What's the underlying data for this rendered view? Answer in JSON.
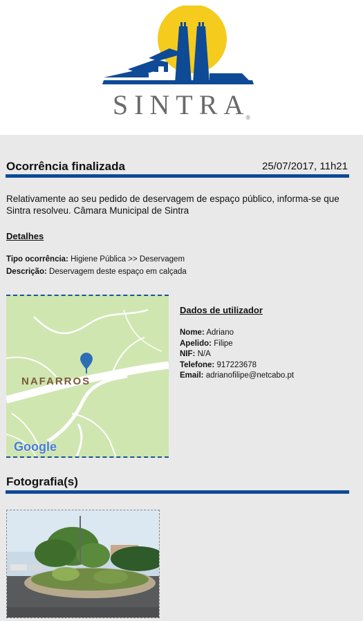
{
  "brand": {
    "name": "SINTRA",
    "mark": "®"
  },
  "notice": {
    "title": "Ocorrência finalizada",
    "date": "25/07/2017, 11h21",
    "message": "Relativamente ao seu pedido de deservagem de espaço público, informa-se que Sintra resolveu. Câmara Municipal de Sintra"
  },
  "details": {
    "heading": "Detalhes",
    "type_label": "Tipo ocorrência:",
    "type_value": "Higiene Pública >> Deservagem",
    "desc_label": "Descrição:",
    "desc_value": "Deservagem deste espaço em calçada"
  },
  "map": {
    "place": "NAFARROS",
    "provider": "Google"
  },
  "user": {
    "heading": "Dados de utilizador",
    "name_label": "Nome:",
    "name_value": "Adriano",
    "surname_label": "Apelido:",
    "surname_value": "Filipe",
    "nif_label": "NIF:",
    "nif_value": "N/A",
    "phone_label": "Telefone:",
    "phone_value": "917223678",
    "email_label": "Email:",
    "email_value": "adrianofilipe@netcabo.pt"
  },
  "photos": {
    "title": "Fotografia(s)"
  },
  "colors": {
    "accent": "#0e4a96",
    "sun": "#f5cb1d",
    "background": "#e9e9e9",
    "map": "#cfe6b0"
  }
}
